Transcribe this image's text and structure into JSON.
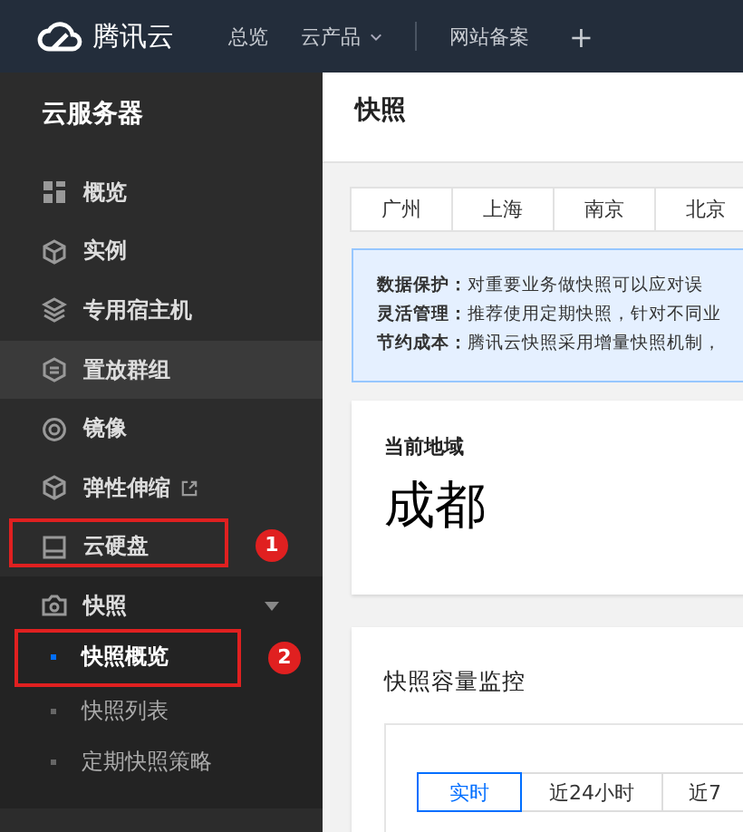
{
  "topbar": {
    "brand": "腾讯云",
    "nav": [
      {
        "label": "总览",
        "dropdown": false
      },
      {
        "label": "云产品",
        "dropdown": true
      },
      {
        "label": "网站备案",
        "dropdown": false
      }
    ],
    "add": "+"
  },
  "sidebar": {
    "title": "云服务器",
    "items": [
      {
        "label": "概览",
        "highlighted": false,
        "external": false
      },
      {
        "label": "实例",
        "highlighted": false,
        "external": false
      },
      {
        "label": "专用宿主机",
        "highlighted": false,
        "external": false
      },
      {
        "label": "置放群组",
        "highlighted": true,
        "external": false
      },
      {
        "label": "镜像",
        "highlighted": false,
        "external": false
      },
      {
        "label": "弹性伸缩",
        "highlighted": false,
        "external": true
      },
      {
        "label": "云硬盘",
        "highlighted": false,
        "external": false,
        "callout": "1"
      },
      {
        "label": "快照",
        "highlighted": false,
        "external": false,
        "expanded": true,
        "children": [
          {
            "label": "快照概览",
            "selected": true,
            "callout": "2"
          },
          {
            "label": "快照列表",
            "selected": false
          },
          {
            "label": "定期快照策略",
            "selected": false
          }
        ]
      }
    ]
  },
  "page": {
    "title": "快照",
    "regions": [
      {
        "label": "广州",
        "selected": false
      },
      {
        "label": "上海",
        "selected": false
      },
      {
        "label": "南京",
        "selected": false
      },
      {
        "label": "北京",
        "selected": false
      }
    ],
    "notice": [
      {
        "term": "数据保护：",
        "text": "对重要业务做快照可以应对误"
      },
      {
        "term": "灵活管理：",
        "text": "推荐使用定期快照，针对不同业"
      },
      {
        "term": "节约成本：",
        "text": "腾讯云快照采用增量快照机制，"
      }
    ],
    "current_region": {
      "label": "当前地域",
      "value": "成都"
    },
    "monitor": {
      "title": "快照容量监控",
      "ranges": [
        {
          "label": "实时",
          "selected": true
        },
        {
          "label": "近24小时",
          "selected": false
        },
        {
          "label": "近7",
          "selected": false
        }
      ]
    }
  }
}
